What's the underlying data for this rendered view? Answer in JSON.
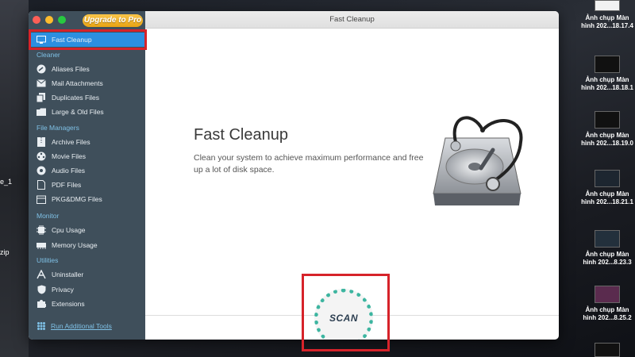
{
  "window": {
    "title": "Fast Cleanup",
    "upgrade_label": "Upgrade to Pro"
  },
  "sidebar": {
    "top_item": {
      "label": "Fast Cleanup",
      "icon": "monitor-icon"
    },
    "sections": [
      {
        "title": "Cleaner",
        "items": [
          {
            "label": "Aliases Files",
            "icon": "alias-icon"
          },
          {
            "label": "Mail Attachments",
            "icon": "mail-icon"
          },
          {
            "label": "Duplicates Files",
            "icon": "duplicate-icon"
          },
          {
            "label": "Large & Old Files",
            "icon": "folder-icon"
          }
        ]
      },
      {
        "title": "File Managers",
        "items": [
          {
            "label": "Archive Files",
            "icon": "archive-icon"
          },
          {
            "label": "Movie Files",
            "icon": "film-icon"
          },
          {
            "label": "Audio Files",
            "icon": "audio-icon"
          },
          {
            "label": "PDF Files",
            "icon": "pdf-icon"
          },
          {
            "label": "PKG&DMG Files",
            "icon": "package-icon"
          }
        ]
      },
      {
        "title": "Monitor",
        "items": [
          {
            "label": "Cpu Usage",
            "icon": "cpu-icon"
          },
          {
            "label": "Memory Usage",
            "icon": "memory-icon"
          }
        ]
      },
      {
        "title": "Utilities",
        "items": [
          {
            "label": "Uninstaller",
            "icon": "uninstall-icon"
          },
          {
            "label": "Privacy",
            "icon": "shield-icon"
          },
          {
            "label": "Extensions",
            "icon": "puzzle-icon"
          }
        ]
      }
    ],
    "run_tools_label": "Run Additional Tools"
  },
  "main": {
    "heading": "Fast Cleanup",
    "description": "Clean your system to achieve maximum performance and free up a lot of disk space.",
    "scan_label": "SCAN"
  },
  "desktop": {
    "left_fragments": [
      "e_1",
      "zip"
    ],
    "files": [
      {
        "line1": "Ảnh chụp Màn",
        "line2": "hình 202...18.17.4"
      },
      {
        "line1": "Ảnh chụp Màn",
        "line2": "hình 202...18.18.1"
      },
      {
        "line1": "Ảnh chụp Màn",
        "line2": "hình 202...18.19.0"
      },
      {
        "line1": "Ảnh chụp Màn",
        "line2": "hình 202...18.21.1"
      },
      {
        "line1": "Ảnh chụp Màn",
        "line2": "hình 202...8.23.3"
      },
      {
        "line1": "Ảnh chụp Màn",
        "line2": "hình 202...8.25.2"
      }
    ]
  },
  "colors": {
    "sidebar": "#3f4f5b",
    "active": "#2c8fe0",
    "section": "#7fc1e6",
    "scan_ring": "#3db5a0",
    "highlight": "#d6232a"
  }
}
